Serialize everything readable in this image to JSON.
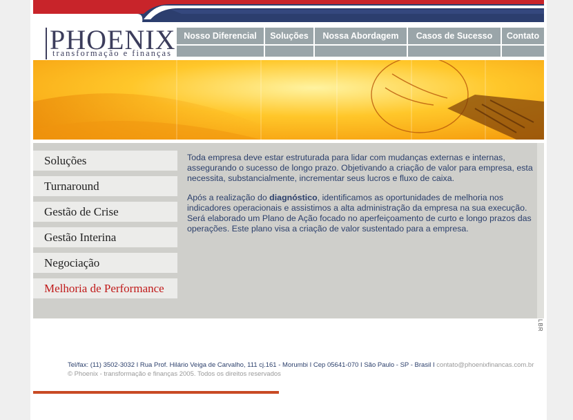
{
  "logo": {
    "title": "PHOENIX",
    "subtitle": "transformação e finanças"
  },
  "nav": [
    {
      "label": "Nosso Diferencial"
    },
    {
      "label": "Soluções"
    },
    {
      "label": "Nossa Abordagem"
    },
    {
      "label": "Casos de Sucesso"
    },
    {
      "label": "Contato"
    }
  ],
  "side_menu": [
    {
      "label": "Soluções"
    },
    {
      "label": "Turnaround"
    },
    {
      "label": "Gestão de Crise"
    },
    {
      "label": "Gestão Interina"
    },
    {
      "label": "Negociação"
    },
    {
      "label": "Melhoria de Performance",
      "active": true
    }
  ],
  "content": {
    "p1": "Toda empresa deve estar estruturada para lidar com mudanças externas e internas, assegurando o sucesso de longo prazo. Objetivando a criação de valor para empresa, esta necessita, substancialmente, incrementar seus lucros e fluxo de caixa.",
    "p2_before": "Após a realização do ",
    "p2_bold": "diagnóstico",
    "p2_after": ", identificamos as oportunidades de melhoria nos indicadores operacionais e assistimos a alta administração da empresa na sua execução. Será elaborado um Plano de Ação focado no aperfeiçoamento de curto e longo prazos das operações. Este plano visa a criação de valor sustentado para a empresa."
  },
  "credit": "LBR",
  "footer": {
    "address": "Tel/fax: (11) 3502-3032 I Rua Prof. Hilário Veiga de Carvalho, 111 cj.161 - Morumbi I Cep 05641-070 I São Paulo - SP - Brasil I ",
    "email": "contato@phoenixfinancas.com.br",
    "copyright": "© Phoenix - transformação e finanças 2005. Todos os direitos reservados"
  },
  "colors": {
    "accent_red": "#c01a1a",
    "nav_gray": "#9aa5a9",
    "text_blue": "#2b3f6b",
    "banner_navy": "#2c3e6e"
  }
}
